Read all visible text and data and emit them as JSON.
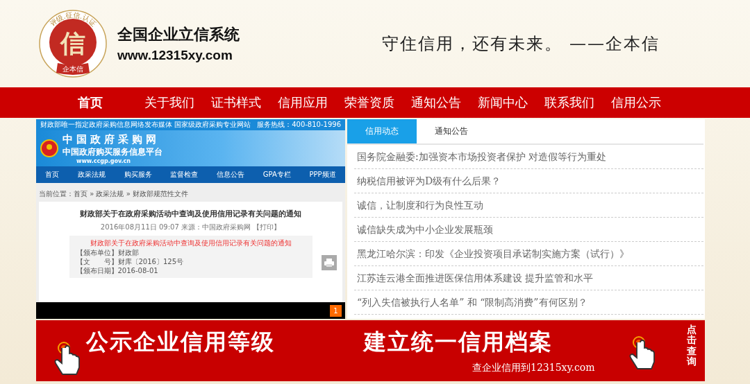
{
  "header": {
    "seal_top": "评级.征信.认证",
    "seal_glyph": "信",
    "seal_bottom": "企本信",
    "site_name": "全国企业立信系统",
    "site_url": "www.12315xy.com",
    "slogan": "守住信用，还有未来。 ——企本信"
  },
  "nav": [
    {
      "label": "首页",
      "selected": true
    },
    {
      "label": "关于我们",
      "selected": false
    },
    {
      "label": "证书样式",
      "selected": false
    },
    {
      "label": "信用应用",
      "selected": false
    },
    {
      "label": "荣誉资质",
      "selected": false
    },
    {
      "label": "通知公告",
      "selected": false
    },
    {
      "label": "新闻中心",
      "selected": false
    },
    {
      "label": "联系我们",
      "selected": false
    },
    {
      "label": "信用公示",
      "selected": false
    }
  ],
  "slide": {
    "top_left": "财政部唯一指定政府采购信息网络发布媒体 国家级政府采购专业网站",
    "top_right": "服务热线：400-810-1996",
    "logo_title": "中国政府采购网",
    "logo_subtitle": "中国政府购买服务信息平台",
    "logo_url": "www.ccgp.gov.cn",
    "nav": [
      "首页",
      "政采法规",
      "购买服务",
      "监督检查",
      "信息公告",
      "GPA专栏",
      "PPP频道"
    ],
    "breadcrumb": "当前位置：首页 » 政采法规 » 财政部规范性文件",
    "title": "财政部关于在政府采购活动中查询及使用信用记录有关问题的通知",
    "meta": "2016年08月11日 09:07 来源：中国政府采购网 【打印】",
    "doc_title": "财政部关于在政府采购活动中查询及使用信用记录有关问题的通知",
    "fields": [
      "【颁布单位】财政部",
      "【文　　号】财库〔2016〕125号",
      "【颁布日期】2016-08-01"
    ],
    "pager": [
      {
        "label": "1",
        "selected": true
      }
    ]
  },
  "tabs": [
    {
      "label": "信用动态",
      "selected": true
    },
    {
      "label": "通知公告",
      "selected": false
    }
  ],
  "news": [
    "国务院金融委:加强资本市场投资者保护 对造假等行为重处",
    "纳税信用被评为D级有什么后果？",
    "诚信，让制度和行为良性互动",
    "诚信缺失成为中小企业发展瓶颈",
    "黑龙江哈尔滨：印发《企业投资项目承诺制实施方案（试行）》",
    "江苏连云港全面推进医保信用体系建设 提升监管和水平",
    "“列入失信被执行人名单” 和 “限制高消费”有何区别？"
  ],
  "banner": {
    "left": "公示企业信用等级",
    "right": "建立统一信用档案",
    "sub": "查企业信用到12315xy.com",
    "action": "点击查询"
  }
}
